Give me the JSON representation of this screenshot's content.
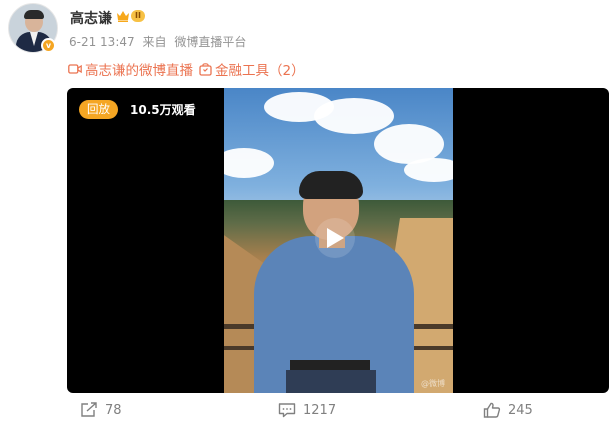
{
  "post": {
    "author": "高志谦",
    "vip_level": "II",
    "avatar_badge": "v",
    "time": "6-21 13:47",
    "source_prefix": "来自",
    "source": "微博直播平台",
    "tags": [
      {
        "icon": "video-camera-icon",
        "label": "高志谦的微博直播"
      },
      {
        "icon": "bag-icon",
        "label": "金融工具（2）"
      }
    ]
  },
  "video": {
    "badge": "回放",
    "views": "10.5万观看",
    "watermark": "@微博"
  },
  "actions": {
    "repost_count": "78",
    "comment_count": "1217",
    "like_count": "245"
  },
  "colors": {
    "accent": "#eb7350",
    "badge": "#f5a623",
    "vip": "#f7c144",
    "meta_text": "#939393"
  }
}
